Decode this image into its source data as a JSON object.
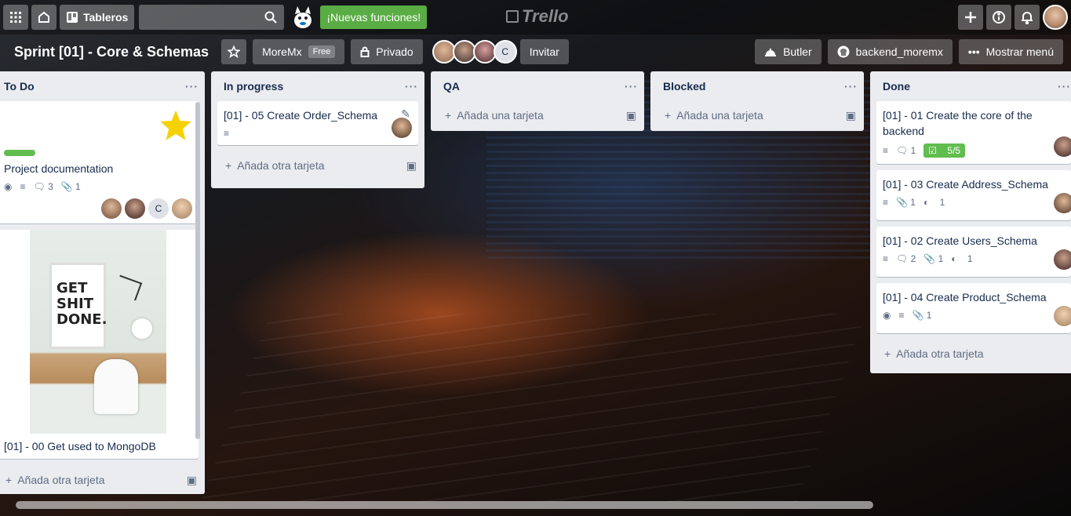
{
  "topbar": {
    "boards_label": "Tableros",
    "new_features_label": "¡Nuevas funciones!",
    "logo_text": "Trello",
    "search_placeholder": ""
  },
  "board": {
    "title": "Sprint [01] - Core & Schemas",
    "team": "MoreMx",
    "team_badge": "Free",
    "visibility": "Privado",
    "invite": "Invitar",
    "member_initial": "C",
    "butler": "Butler",
    "github": "backend_moremx",
    "menu": "Mostrar menú"
  },
  "lists": [
    {
      "title": "To Do",
      "cards": [
        {
          "title": "Project documentation",
          "label_color": "#61bd4f",
          "badges": {
            "comments": "3",
            "attachments": "1"
          },
          "sticker": "star",
          "member_initial": "C"
        },
        {
          "title": "[01] - 00 Get used to MongoDB",
          "cover_text": "GET SHIT DONE."
        }
      ],
      "add": "Añada otra tarjeta"
    },
    {
      "title": "In progress",
      "cards": [
        {
          "title": "[01] - 05 Create Order_Schema"
        }
      ],
      "add": "Añada otra tarjeta"
    },
    {
      "title": "QA",
      "cards": [],
      "add": "Añada una tarjeta"
    },
    {
      "title": "Blocked",
      "cards": [],
      "add": "Añada una tarjeta"
    },
    {
      "title": "Done",
      "cards": [
        {
          "title": "[01] - 01 Create the core of the backend",
          "badges": {
            "comments": "1",
            "checklist": "5/5"
          }
        },
        {
          "title": "[01] - 03 Create Address_Schema",
          "badges": {
            "attachments": "1",
            "github": "1"
          }
        },
        {
          "title": "[01] - 02 Create Users_Schema",
          "badges": {
            "comments": "2",
            "attachments": "1",
            "github": "1"
          }
        },
        {
          "title": "[01] - 04 Create Product_Schema",
          "badges": {
            "attachments": "1"
          }
        }
      ],
      "add": "Añada otra tarjeta"
    }
  ],
  "colors": {
    "accent_green": "#5aac44",
    "list_bg": "#ebecf0",
    "label_green": "#61bd4f"
  }
}
